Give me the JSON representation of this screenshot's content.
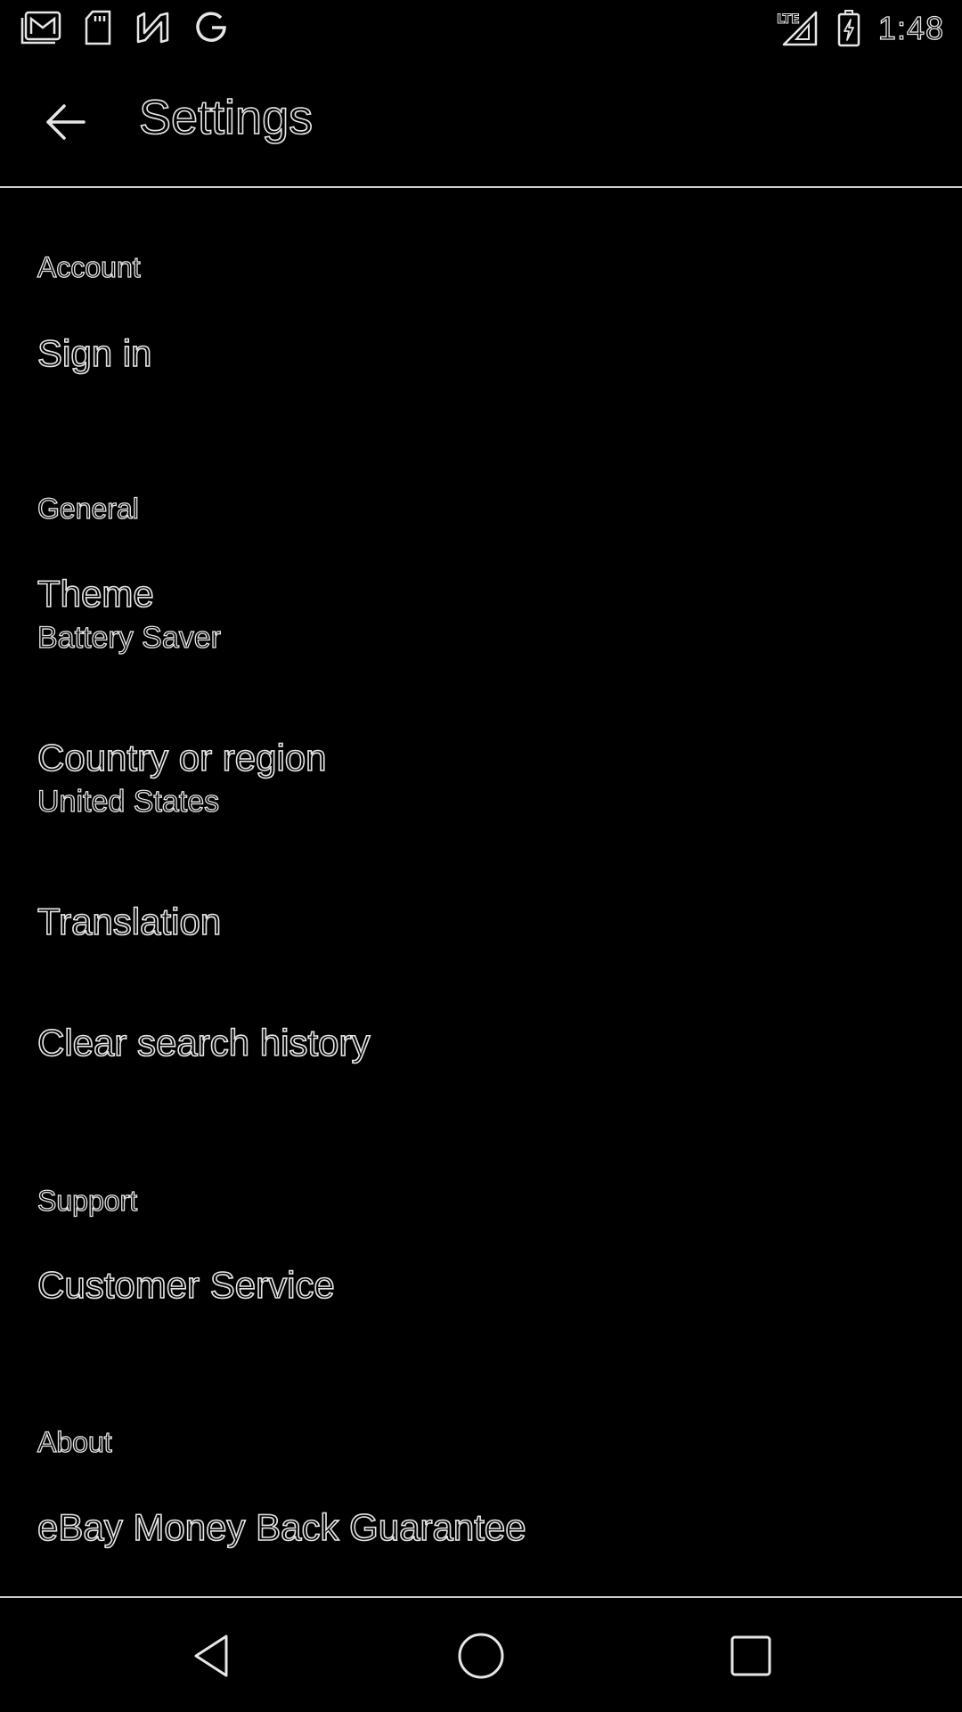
{
  "status_bar": {
    "time": "1:48",
    "left_icons": [
      "gmail-icon",
      "sd-card-icon",
      "n-app-icon",
      "google-icon"
    ],
    "right_icons": [
      "lte-signal-icon",
      "battery-charging-icon"
    ]
  },
  "app_bar": {
    "title": "Settings",
    "back_icon": "arrow-left-icon"
  },
  "sections": {
    "account": {
      "header": "Account",
      "sign_in": "Sign in"
    },
    "general": {
      "header": "General",
      "theme_title": "Theme",
      "theme_value": "Battery Saver",
      "country_title": "Country or region",
      "country_value": "United States",
      "translation": "Translation",
      "clear_history": "Clear search history"
    },
    "support": {
      "header": "Support",
      "customer_service": "Customer Service"
    },
    "about": {
      "header": "About",
      "money_back": "eBay Money Back Guarantee"
    }
  },
  "nav_bar": {
    "icons": [
      "back-triangle-icon",
      "home-circle-icon",
      "recents-square-icon"
    ]
  }
}
